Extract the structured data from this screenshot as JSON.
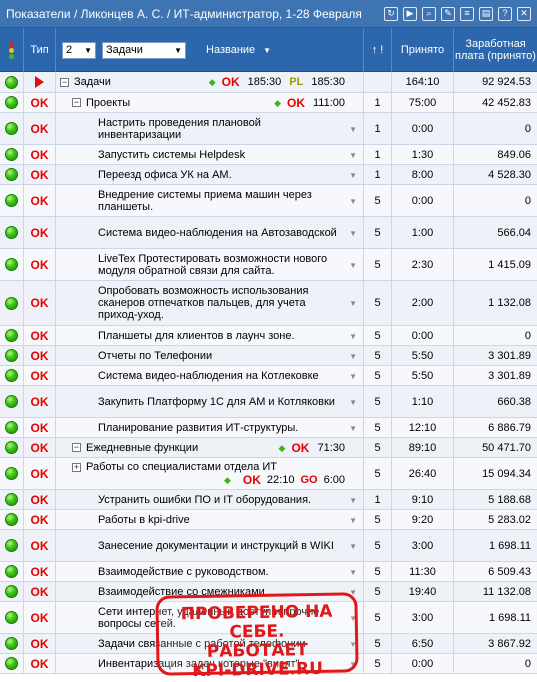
{
  "titlebar": {
    "title": "Показатели / Ликонцев А. С. / ИТ-администратор, 1-28 Февраля",
    "icons": [
      "refresh-icon",
      "play-icon",
      "search-icon",
      "wrench-icon",
      "list-icon",
      "csv-icon",
      "info-icon",
      "close-icon"
    ]
  },
  "header": {
    "type_label": "Тип",
    "depth_value": "2",
    "filter_value": "Задачи",
    "name_label": "Название",
    "prio_label": "↑ !",
    "accepted_label": "Принято",
    "salary_label": "Заработная плата (принято)"
  },
  "rows": [
    {
      "kind": "group",
      "name": "Задачи",
      "status1": "OK",
      "time1": "185:30",
      "status2": "PL",
      "time2": "185:30",
      "prio": "",
      "accepted": "164:10",
      "salary": "92 924.53",
      "type": "arrow",
      "indent": 0,
      "h": 21
    },
    {
      "kind": "group",
      "name": "Проекты",
      "status1": "OK",
      "time1": "111:00",
      "prio": "1",
      "accepted": "75:00",
      "salary": "42 452.83",
      "type": "OK",
      "indent": 1,
      "h": 20
    },
    {
      "kind": "task",
      "name": "Настрить проведения плановой инвентаризации",
      "prio": "1",
      "accepted": "0:00",
      "salary": "0",
      "type": "OK",
      "h": 32
    },
    {
      "kind": "task",
      "name": "Запустить системы Helpdesk",
      "prio": "1",
      "accepted": "1:30",
      "salary": "849.06",
      "type": "OK",
      "h": 20
    },
    {
      "kind": "task",
      "name": "Переезд офиса УК на АМ.",
      "prio": "1",
      "accepted": "8:00",
      "salary": "4 528.30",
      "type": "OK",
      "h": 20
    },
    {
      "kind": "task",
      "name": "Внедрение системы приема машин через планшеты.",
      "prio": "5",
      "accepted": "0:00",
      "salary": "0",
      "type": "OK",
      "h": 32
    },
    {
      "kind": "task",
      "name": "Система видео-наблюдения на Автозаводской",
      "prio": "5",
      "accepted": "1:00",
      "salary": "566.04",
      "type": "OK",
      "h": 32
    },
    {
      "kind": "task",
      "name": "LiveTex Протестировать возможности нового модуля обратной связи для сайта.",
      "prio": "5",
      "accepted": "2:30",
      "salary": "1 415.09",
      "type": "OK",
      "h": 32
    },
    {
      "kind": "task",
      "name": "Опробовать возможность использования сканеров отпечатков пальцев, для учета приход-уход.",
      "prio": "5",
      "accepted": "2:00",
      "salary": "1 132.08",
      "type": "OK",
      "h": 45
    },
    {
      "kind": "task",
      "name": "Планшеты для клиентов в лаунч зоне.",
      "prio": "5",
      "accepted": "0:00",
      "salary": "0",
      "type": "OK",
      "h": 20
    },
    {
      "kind": "task",
      "name": "Отчеты по Телефонии",
      "prio": "5",
      "accepted": "5:50",
      "salary": "3 301.89",
      "type": "OK",
      "h": 20
    },
    {
      "kind": "task",
      "name": "Система видео-наблюдения на Котлековке",
      "prio": "5",
      "accepted": "5:50",
      "salary": "3 301.89",
      "type": "OK",
      "h": 20
    },
    {
      "kind": "task",
      "name": "Закупить Платформу 1С для АМ и Котляковки",
      "prio": "5",
      "accepted": "1:10",
      "salary": "660.38",
      "type": "OK",
      "h": 32
    },
    {
      "kind": "task",
      "name": "Планирование развития ИТ-структуры.",
      "prio": "5",
      "accepted": "12:10",
      "salary": "6 886.79",
      "type": "OK",
      "h": 20
    },
    {
      "kind": "group",
      "name": "Ежедневные функции",
      "status1": "OK",
      "time1": "71:30",
      "prio": "5",
      "accepted": "89:10",
      "salary": "50 471.70",
      "type": "OK",
      "indent": 1,
      "h": 20
    },
    {
      "kind": "subgroup",
      "name": "Работы со специалистами отдела ИТ",
      "status1": "OK",
      "time1": "22:10",
      "status2": "GO",
      "time2": "6:00",
      "prio": "5",
      "accepted": "26:40",
      "salary": "15 094.34",
      "type": "OK",
      "h": 32
    },
    {
      "kind": "task",
      "name": "Устранить ошибки ПО и IT оборудования.",
      "prio": "1",
      "accepted": "9:10",
      "salary": "5 188.68",
      "type": "OK",
      "h": 20
    },
    {
      "kind": "task",
      "name": "Работы в kpi-drive",
      "prio": "5",
      "accepted": "9:20",
      "salary": "5 283.02",
      "type": "OK",
      "h": 20
    },
    {
      "kind": "task",
      "name": "Занесение документации и инструкций в WIKI",
      "prio": "5",
      "accepted": "3:00",
      "salary": "1 698.11",
      "type": "OK",
      "h": 32
    },
    {
      "kind": "task",
      "name": "Взаимодействие с руководством.",
      "prio": "5",
      "accepted": "11:30",
      "salary": "6 509.43",
      "type": "OK",
      "h": 20
    },
    {
      "kind": "task",
      "name": "Взаимодействие со смежниками",
      "prio": "5",
      "accepted": "19:40",
      "salary": "11 132.08",
      "type": "OK",
      "h": 20
    },
    {
      "kind": "task",
      "name": "Сети интернет, удаленный доступ и прочие вопросы сетей.",
      "prio": "5",
      "accepted": "3:00",
      "salary": "1 698.11",
      "type": "OK",
      "h": 32
    },
    {
      "kind": "task",
      "name": "Задачи связанные с работой телефонии",
      "prio": "5",
      "accepted": "6:50",
      "salary": "3 867.92",
      "type": "OK",
      "h": 20
    },
    {
      "kind": "task",
      "name": "Инвентаризация задач которые \"висят\"",
      "prio": "5",
      "accepted": "0:00",
      "salary": "0",
      "type": "OK",
      "h": 20
    }
  ],
  "stamp": {
    "line1": "ПРОВЕРЕНО НА СЕБЕ.",
    "line2": "РАБОТАЕТ",
    "line3": "KPI-DRIVE.RU"
  },
  "colors": {
    "header_bg": "#2c66ad",
    "ok_red": "#e60000",
    "pl_olive": "#999900",
    "indicator_green": "#39c216"
  }
}
